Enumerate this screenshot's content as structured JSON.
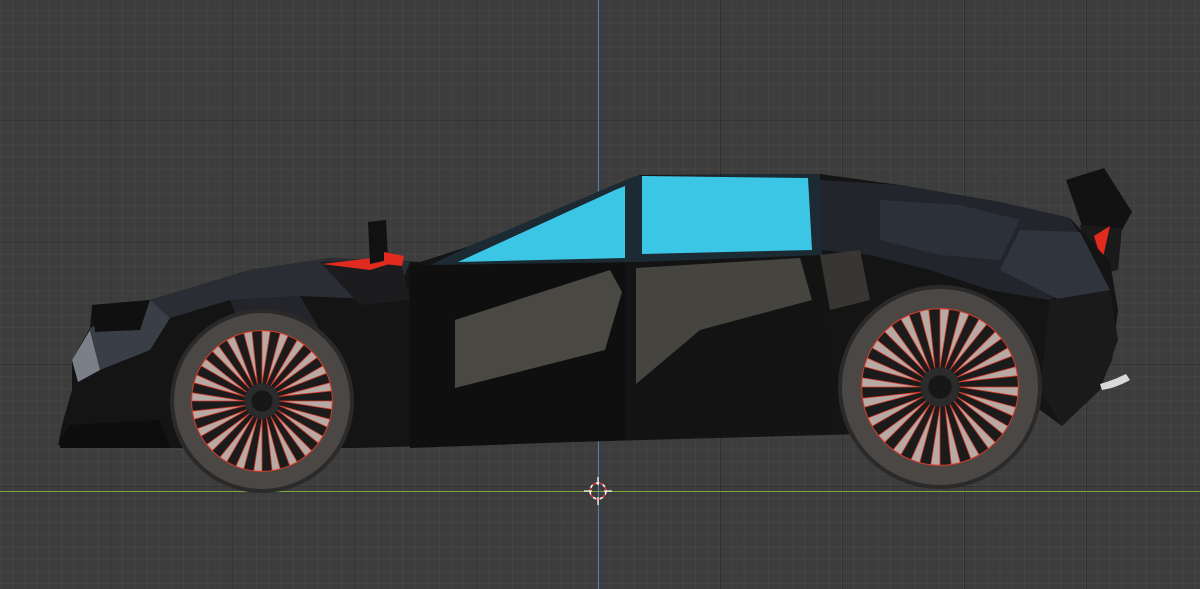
{
  "viewport": {
    "grid_color": "#2f2f2f",
    "background": "#3d3d3d"
  },
  "axes": {
    "z_axis_color": "#4b7fc1",
    "x_axis_color": "#7aa83a"
  },
  "car": {
    "body_color": "#141414",
    "body_highlight": "#4a4a44",
    "glass_color": "#3cc6e6",
    "trim_color": "#e02b1e",
    "tire_color": "#4a4744",
    "rim_spoke_color": "#b7a9a3",
    "rim_outline_color": "#d63a2a"
  },
  "icons": {
    "cursor": "3d-cursor-icon"
  }
}
